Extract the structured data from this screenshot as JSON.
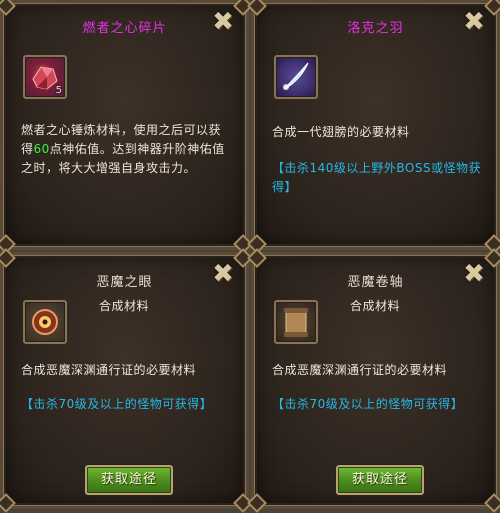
{
  "panels": [
    {
      "title": "燃者之心碎片",
      "icon": "ruby-shard-icon",
      "count": "5",
      "desc_a": "燃者之心锤炼材料，使用之后可以获",
      "desc_b1": "得",
      "desc_value": "60",
      "desc_b2": "点神佑值。达到神器升阶神佑值",
      "desc_c": "之时，将大大增强自身攻击力。"
    },
    {
      "title": "洛克之羽",
      "icon": "feather-icon",
      "desc": "合成一代翅膀的必要材料",
      "source_a": "【击杀140级以上野外BOSS或怪物获",
      "source_b": "得】"
    },
    {
      "title": "恶魔之眼",
      "icon": "demon-eye-icon",
      "type": "合成材料",
      "desc": "合成恶魔深渊通行证的必要材料",
      "source": "【击杀70级及以上的怪物可获得】",
      "button": "获取途径"
    },
    {
      "title": "恶魔卷轴",
      "icon": "demon-scroll-icon",
      "type": "合成材料",
      "desc": "合成恶魔深渊通行证的必要材料",
      "source": "【击杀70级及以上的怪物可获得】",
      "button": "获取途径"
    }
  ],
  "close_glyph": "✖",
  "colors": {
    "title_magenta": "#e533e5",
    "highlight_green": "#3df03d",
    "source_cyan": "#25b8e6",
    "button_green": "#4f8f1f"
  }
}
